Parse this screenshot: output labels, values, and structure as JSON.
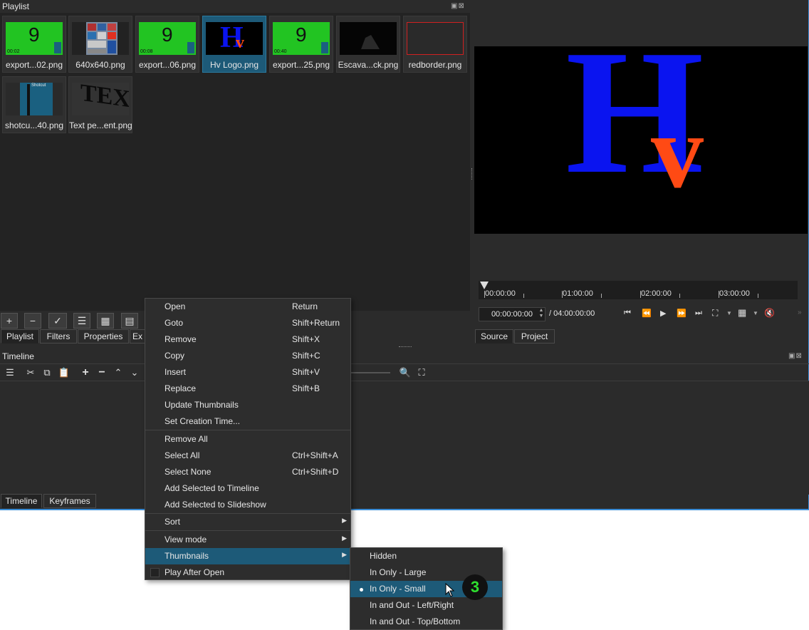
{
  "playlist": {
    "title": "Playlist",
    "items": [
      {
        "caption": "export...02.png",
        "kind": "green",
        "timecode": "00:02"
      },
      {
        "caption": "640x640.png",
        "kind": "containers"
      },
      {
        "caption": "export...06.png",
        "kind": "green",
        "timecode": "00:08"
      },
      {
        "caption": "Hv Logo.png",
        "kind": "logo",
        "selected": true
      },
      {
        "caption": "export...25.png",
        "kind": "green",
        "timecode": "00:40"
      },
      {
        "caption": "Escava...ck.png",
        "kind": "dark"
      },
      {
        "caption": "redborder.png",
        "kind": "redborder"
      },
      {
        "caption": "shotcu...40.png",
        "kind": "shotcut",
        "inner_text": "Shotcut"
      },
      {
        "caption": "Text pe...ent.png",
        "kind": "text",
        "inner_text": "TEXT"
      }
    ],
    "thumb_digit": "9",
    "tabs": [
      "Playlist",
      "Filters",
      "Properties",
      "Ex"
    ]
  },
  "toolbar": {
    "add": "+",
    "remove": "−",
    "update": "✓",
    "details": "☰",
    "tiles": "▦",
    "icons": "▤"
  },
  "viewer": {
    "logo_letter_big": "H",
    "logo_letter_small": "v",
    "ruler_labels": [
      "00:00:00",
      "01:00:00",
      "02:00:00",
      "03:00:00"
    ],
    "timecode_current": "00:00:00:00",
    "timecode_total": "/ 04:00:00:00",
    "tabs": [
      "Source",
      "Project"
    ]
  },
  "timeline": {
    "title": "Timeline",
    "tabs": [
      "Timeline",
      "Keyframes"
    ]
  },
  "context_menu": {
    "items": [
      {
        "label": "Open",
        "shortcut": "Return"
      },
      {
        "label": "Goto",
        "shortcut": "Shift+Return"
      },
      {
        "label": "Remove",
        "shortcut": "Shift+X"
      },
      {
        "label": "Copy",
        "shortcut": "Shift+C"
      },
      {
        "label": "Insert",
        "shortcut": "Shift+V"
      },
      {
        "label": "Replace",
        "shortcut": "Shift+B"
      },
      {
        "label": "Update Thumbnails",
        "shortcut": ""
      },
      {
        "label": "Set Creation Time...",
        "shortcut": ""
      },
      {
        "label": "Remove All",
        "shortcut": ""
      },
      {
        "label": "Select All",
        "shortcut": "Ctrl+Shift+A"
      },
      {
        "label": "Select None",
        "shortcut": "Ctrl+Shift+D"
      },
      {
        "label": "Add Selected to Timeline",
        "shortcut": ""
      },
      {
        "label": "Add Selected to Slideshow",
        "shortcut": ""
      },
      {
        "label": "Sort",
        "shortcut": ""
      },
      {
        "label": "View mode",
        "shortcut": ""
      },
      {
        "label": "Thumbnails",
        "shortcut": ""
      },
      {
        "label": "Play After Open",
        "shortcut": ""
      }
    ]
  },
  "thumbnails_submenu": {
    "items": [
      "Hidden",
      "In Only - Large",
      "In Only - Small",
      "In and Out - Left/Right",
      "In and Out - Top/Bottom"
    ],
    "selected": "In Only - Small"
  },
  "annotation": {
    "step": "3"
  },
  "colors": {
    "accent": "#1d5a78",
    "logo_blue": "#0a14f0",
    "logo_orange": "#ff4a14",
    "thumb_green": "#22c422"
  }
}
